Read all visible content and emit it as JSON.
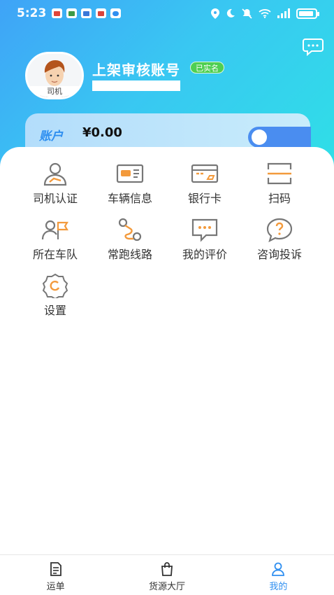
{
  "status_bar": {
    "time": "5:23"
  },
  "profile": {
    "account_name": "上架审核账号",
    "verified_badge": "已实名",
    "role_tag": "司机"
  },
  "account": {
    "label": "账户",
    "balance": "¥0.00"
  },
  "menu": {
    "items": [
      {
        "label": "司机认证",
        "icon": "driver-id-icon"
      },
      {
        "label": "车辆信息",
        "icon": "vehicle-card-icon"
      },
      {
        "label": "银行卡",
        "icon": "bank-card-icon"
      },
      {
        "label": "扫码",
        "icon": "scan-icon"
      },
      {
        "label": "所在车队",
        "icon": "team-flag-icon"
      },
      {
        "label": "常跑线路",
        "icon": "route-icon"
      },
      {
        "label": "我的评价",
        "icon": "review-icon"
      },
      {
        "label": "咨询投诉",
        "icon": "help-icon"
      },
      {
        "label": "设置",
        "icon": "settings-icon"
      }
    ]
  },
  "tabbar": {
    "items": [
      {
        "label": "运单",
        "icon": "waybill-icon",
        "active": false
      },
      {
        "label": "货源大厅",
        "icon": "shopping-bag-icon",
        "active": false
      },
      {
        "label": "我的",
        "icon": "user-icon",
        "active": true
      }
    ]
  },
  "colors": {
    "accent": "#2f8ff0",
    "icon_orange": "#f39a3c",
    "icon_gray": "#777777"
  }
}
